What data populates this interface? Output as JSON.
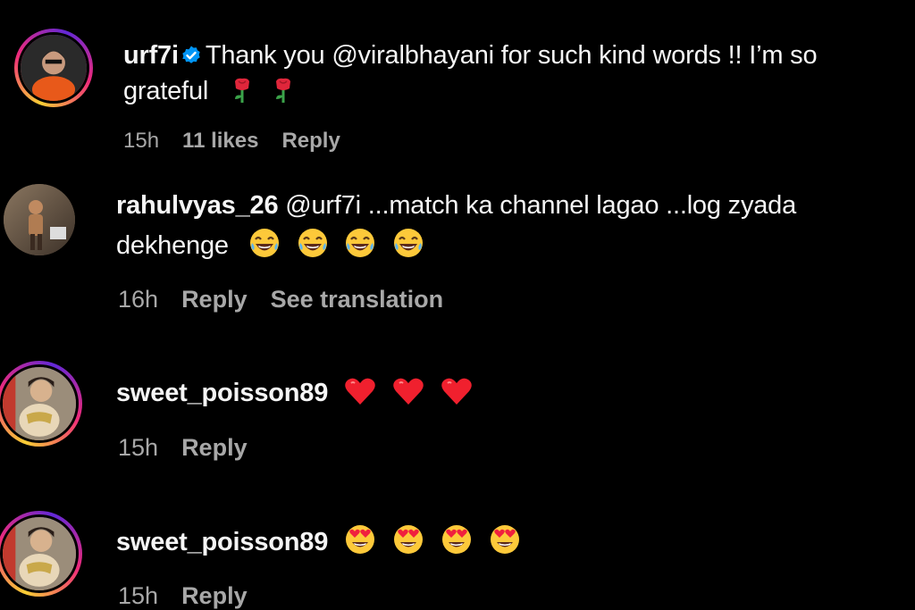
{
  "comments": [
    {
      "username": "urf7i",
      "verified": true,
      "text_line1": "Thank you @viralbhayani for such kind words !! I’m so",
      "text_line2": "grateful",
      "emoji": [
        "rose-icon",
        "rose-icon"
      ],
      "time": "15h",
      "likes": "11 likes",
      "reply": "Reply"
    },
    {
      "username": "rahulvyas_26",
      "text_line1": "@urf7i ...match ka channel lagao ...log zyada",
      "text_line2": "dekhenge",
      "emoji": [
        "laughing-face-icon",
        "laughing-face-icon",
        "laughing-face-icon",
        "laughing-face-icon"
      ],
      "time": "16h",
      "reply": "Reply",
      "translation": "See translation"
    },
    {
      "username": "sweet_poisson89",
      "emoji": [
        "red-heart-icon",
        "red-heart-icon",
        "red-heart-icon"
      ],
      "time": "15h",
      "reply": "Reply"
    },
    {
      "username": "sweet_poisson89",
      "emoji": [
        "heart-eyes-face-icon",
        "heart-eyes-face-icon",
        "heart-eyes-face-icon",
        "heart-eyes-face-icon"
      ],
      "time": "15h",
      "reply": "Reply"
    }
  ],
  "colors": {
    "background": "#000000",
    "text": "#f5f5f5",
    "meta": "#a8a8a8",
    "verified": "#0095f6"
  }
}
